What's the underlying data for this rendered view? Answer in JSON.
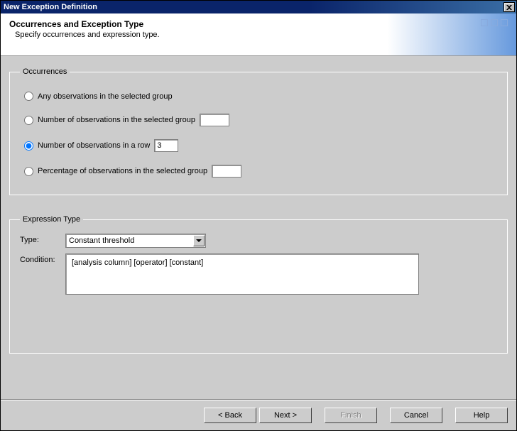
{
  "window": {
    "title": "New Exception Definition"
  },
  "header": {
    "title": "Occurrences and Exception Type",
    "subtitle": "Specify occurrences and expression type."
  },
  "occurrences": {
    "legend": "Occurrences",
    "options": {
      "any": "Any observations in the selected group",
      "num_group": "Number of observations in the selected group",
      "num_row": "Number of observations in a row",
      "pct_group": "Percentage of observations in the selected group"
    },
    "values": {
      "num_group": "",
      "num_row": "3",
      "pct_group": ""
    },
    "selected": "num_row"
  },
  "expression": {
    "legend": "Expression Type",
    "type_label": "Type:",
    "type_value": "Constant threshold",
    "condition_label": "Condition:",
    "condition_value": "[analysis column] [operator] [constant]"
  },
  "buttons": {
    "back": "< Back",
    "next": "Next >",
    "finish": "Finish",
    "cancel": "Cancel",
    "help": "Help"
  }
}
